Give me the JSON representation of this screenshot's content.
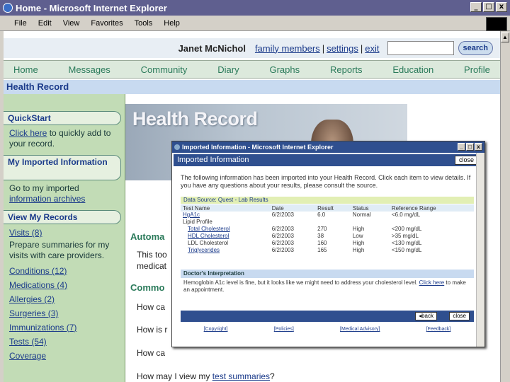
{
  "window": {
    "title": "Home - Microsoft Internet Explorer",
    "buttons": [
      "_",
      "□",
      "x"
    ]
  },
  "menu": [
    "File",
    "Edit",
    "View",
    "Favorites",
    "Tools",
    "Help"
  ],
  "user": {
    "name": "Janet McNichol",
    "links": [
      "family members",
      "settings",
      "exit"
    ],
    "search_label": "search",
    "search_value": ""
  },
  "nav": [
    "Home",
    "Messages",
    "Community",
    "Diary",
    "Graphs",
    "Reports",
    "Education",
    "Profile"
  ],
  "section_title": "Health Record",
  "hero_title": "Health Record",
  "sidebar": {
    "quickstart": {
      "title": "QuickStart",
      "link": "Click here",
      "text": " to quickly add to your record."
    },
    "imported": {
      "title": "My Imported Information",
      "text": "Go to my imported ",
      "link": "information archives"
    },
    "records": {
      "title": "View My Records",
      "visits": "Visits (8)",
      "visits_desc": "Prepare summaries for my visits with care providers.",
      "items": [
        "Conditions (12)",
        "Medications (4)",
        "Allergies (2)",
        "Surgeries (3)",
        "Immunizations (7)",
        "Tests (54)",
        "Coverage"
      ]
    }
  },
  "main": {
    "auto_title": "Automa",
    "auto_text1": "This too",
    "auto_text2": "medicat",
    "common_title": "Commo",
    "q1": "How ca",
    "q2": "How is r",
    "q3": "How ca",
    "q4": "How may I view my ",
    "q4_link": "test summaries",
    "q4_end": "?"
  },
  "modal": {
    "title": "Imported Information - Microsoft Internet Explorer",
    "win_buttons": [
      "_",
      "□",
      "x"
    ],
    "header": "Imported Information",
    "close": "close",
    "intro": "The following information has been imported into your Health Record. Click each item to view details. If you have any questions about your results, please consult the source.",
    "source": "Data Source: Quest - Lab Results",
    "columns": [
      "Test Name",
      "Date",
      "Result",
      "Status",
      "Reference Range"
    ],
    "rows": [
      {
        "name": "HgA1c",
        "date": "6/2/2003",
        "result": "6.0",
        "status": "Normal",
        "range": "<6.0 mg/dL"
      },
      {
        "name": "Lipid Profile",
        "date": "",
        "result": "",
        "status": "",
        "range": ""
      },
      {
        "name": "Total Cholesterol",
        "date": "6/2/2003",
        "result": "270",
        "status": "High",
        "range": "<200 mg/dL"
      },
      {
        "name": "HDL Cholesterol",
        "date": "6/2/2003",
        "result": "38",
        "status": "Low",
        "range": ">35 mg/dL"
      },
      {
        "name": "LDL Cholesterol",
        "date": "6/2/2003",
        "result": "160",
        "status": "High",
        "range": "<130 mg/dL"
      },
      {
        "name": "Triglycerides",
        "date": "6/2/2003",
        "result": "165",
        "status": "High",
        "range": "<150 mg/dL"
      }
    ],
    "interp_title": "Doctor's Interpretation",
    "interp_text": "Hemoglobin A1c level is fine, but it looks like we might need to address your cholesterol level. ",
    "interp_link": "Click here",
    "interp_end": " to make an appointment.",
    "back": "back",
    "close2": "close",
    "footer": [
      "Copyright",
      "Policies",
      "Medical Advisory",
      "Feedback"
    ]
  }
}
